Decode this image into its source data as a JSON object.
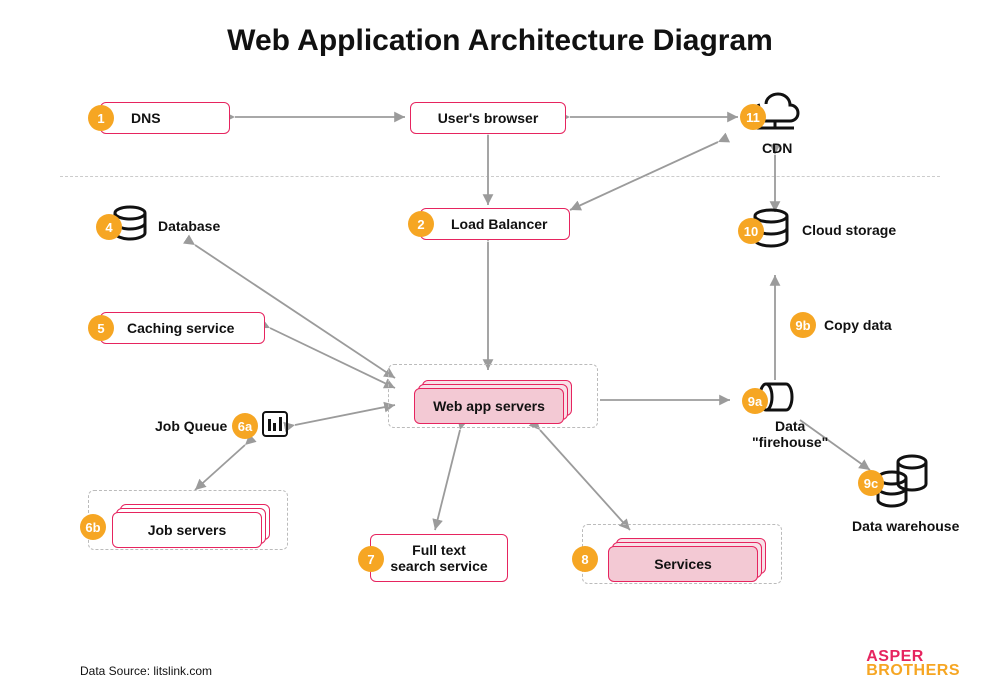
{
  "title": "Web Application Architecture Diagram",
  "source": "Data Source: litslink.com",
  "logo": {
    "line1": "ASPER",
    "line2": "BROTHERS"
  },
  "nodes": {
    "dns": {
      "num": "1",
      "label": "DNS"
    },
    "browser": {
      "label": "User's browser"
    },
    "cdn": {
      "num": "11",
      "label": "CDN"
    },
    "load_balancer": {
      "num": "2",
      "label": "Load Balancer"
    },
    "database": {
      "num": "4",
      "label": "Database"
    },
    "caching": {
      "num": "5",
      "label": "Caching service"
    },
    "job_queue": {
      "num": "6a",
      "label": "Job Queue"
    },
    "job_servers": {
      "num": "6b",
      "label": "Job servers"
    },
    "web_app": {
      "label": "Web app servers"
    },
    "fulltext": {
      "num": "7",
      "label": "Full text\nsearch service"
    },
    "services": {
      "num": "8",
      "label": "Services"
    },
    "firehose": {
      "num": "9a",
      "label": "Data\n\"firehouse\""
    },
    "copy_data": {
      "num": "9b",
      "label": "Copy data"
    },
    "warehouse": {
      "num": "9c",
      "label": "Data warehouse"
    },
    "cloud_storage": {
      "num": "10",
      "label": "Cloud storage"
    }
  }
}
